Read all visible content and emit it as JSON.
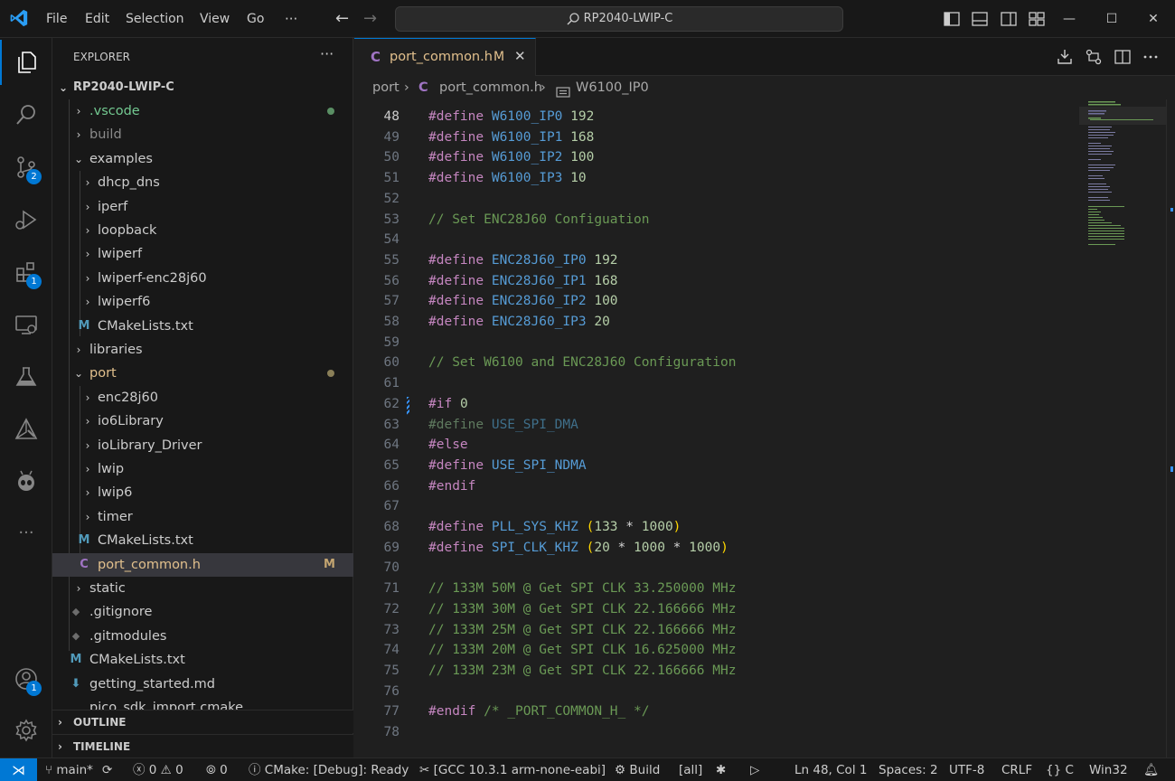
{
  "titlebar": {
    "menus": [
      "File",
      "Edit",
      "Selection",
      "View",
      "Go"
    ],
    "more": "···",
    "search": "RP2040-LWIP-C",
    "window_minimize": "—",
    "window_maximize": "☐",
    "window_close": "✕"
  },
  "activity": {
    "source_control_badge": "2",
    "extensions_badge": "1",
    "accounts_badge": "1",
    "more": "···"
  },
  "sidebar": {
    "title": "EXPLORER",
    "more": "···",
    "root": "RP2040-LWIP-C",
    "items": [
      {
        "label": "v",
        "text": ".vscode",
        "color": "#73c991",
        "dot": "#5a8f64"
      },
      {
        "text": "build",
        "color": "#8b8b8b"
      },
      {
        "text": "examples"
      },
      {
        "text": "dhcp_dns"
      },
      {
        "text": "iperf"
      },
      {
        "text": "loopback"
      },
      {
        "text": "lwiperf"
      },
      {
        "text": "lwiperf-enc28j60"
      },
      {
        "text": "lwiperf6"
      },
      {
        "text": "CMakeLists.txt",
        "icon": "M"
      },
      {
        "text": "libraries"
      },
      {
        "text": "port",
        "dot": "#8a7f58"
      },
      {
        "text": "enc28j60"
      },
      {
        "text": "io6Library"
      },
      {
        "text": "ioLibrary_Driver"
      },
      {
        "text": "lwip"
      },
      {
        "text": "lwip6"
      },
      {
        "text": "timer"
      },
      {
        "text": "CMakeLists.txt",
        "icon": "M"
      },
      {
        "text": "port_common.h",
        "icon": "C",
        "flag": "M",
        "color": "#e2c08d"
      },
      {
        "text": "static"
      },
      {
        "text": ".gitignore",
        "icon": "◆"
      },
      {
        "text": ".gitmodules",
        "icon": "◆"
      },
      {
        "text": "CMakeLists.txt",
        "icon": "M"
      },
      {
        "text": "getting_started.md",
        "icon": "⬇"
      },
      {
        "text": "pico_sdk_import.cmake"
      }
    ],
    "outline": "OUTLINE",
    "timeline": "TIMELINE"
  },
  "tab": {
    "icon": "C",
    "name": "port_common.h",
    "modified": "M",
    "close": "✕"
  },
  "breadcrumb": {
    "folder": "port",
    "file": "port_common.h",
    "symbol": "W6100_IP0"
  },
  "code": {
    "first_line": 48,
    "lines": [
      "#define W6100_IP0 192",
      "#define W6100_IP1 168",
      "#define W6100_IP2 100",
      "#define W6100_IP3 10",
      "",
      "// Set ENC28J60 Configuation",
      "",
      "#define ENC28J60_IP0 192",
      "#define ENC28J60_IP1 168",
      "#define ENC28J60_IP2 100",
      "#define ENC28J60_IP3 20",
      "",
      "// Set W6100 and ENC28J60 Configuration",
      "",
      "#if 0",
      "#define USE_SPI_DMA",
      "#else",
      "#define USE_SPI_NDMA",
      "#endif",
      "",
      "#define PLL_SYS_KHZ (133 * 1000)",
      "#define SPI_CLK_KHZ (20 * 1000 * 1000)",
      "",
      "// 133M 50M @ Get SPI CLK 33.250000 MHz",
      "// 133M 30M @ Get SPI CLK 22.166666 MHz",
      "// 133M 25M @ Get SPI CLK 22.166666 MHz",
      "// 133M 20M @ Get SPI CLK 16.625000 MHz",
      "// 133M 23M @ Get SPI CLK 22.166666 MHz",
      "",
      "#endif /* _PORT_COMMON_H_ */",
      ""
    ]
  },
  "statusbar": {
    "branch": "main*",
    "errors": "0",
    "warnings": "0",
    "ports": "0",
    "cmake": "CMake: [Debug]: Ready",
    "kit": "[GCC 10.3.1 arm-none-eabi]",
    "build": "Build",
    "target": "[all]",
    "cursor": "Ln 48, Col 1",
    "spaces": "Spaces: 2",
    "encoding": "UTF-8",
    "eol": "CRLF",
    "language": "C",
    "platform": "Win32"
  }
}
